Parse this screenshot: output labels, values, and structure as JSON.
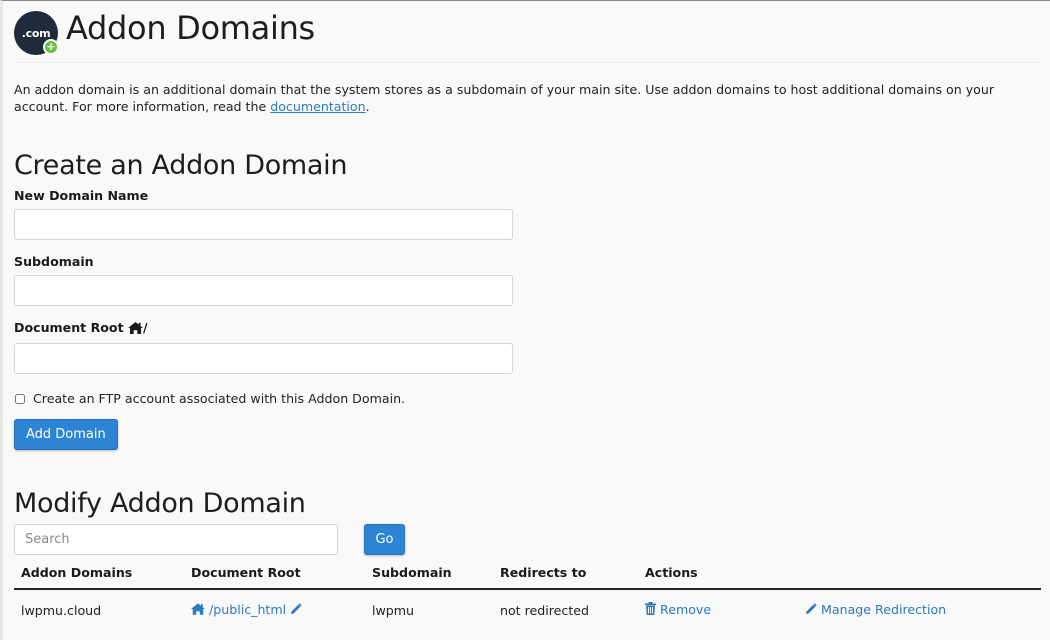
{
  "header": {
    "logo_text": ".com",
    "logo_badge": "+",
    "title": "Addon Domains"
  },
  "intro": {
    "text": "An addon domain is an additional domain that the system stores as a subdomain of your main site. Use addon domains to host additional domains on your account. For more information, read the ",
    "link_text": "documentation",
    "suffix": "."
  },
  "create": {
    "title": "Create an Addon Domain",
    "fields": [
      {
        "label": "New Domain Name",
        "value": "",
        "placeholder": ""
      },
      {
        "label": "Subdomain",
        "value": "",
        "placeholder": ""
      },
      {
        "label": "Document Root",
        "label_suffix": "/",
        "value": "",
        "placeholder": ""
      }
    ],
    "ftp_checkbox": {
      "label": "Create an FTP account associated with this Addon Domain.",
      "checked": false
    },
    "submit_label": "Add Domain"
  },
  "modify": {
    "title": "Modify Addon Domain",
    "search": {
      "placeholder": "Search",
      "value": ""
    },
    "go_label": "Go",
    "columns": [
      "Addon Domains",
      "Document Root",
      "Subdomain",
      "Redirects to",
      "Actions",
      ""
    ],
    "rows": [
      {
        "domain": "lwpmu.cloud",
        "document_root": "/public_html",
        "subdomain": "lwpmu",
        "redirects_to": "not redirected",
        "remove_label": "Remove",
        "manage_redirection_label": "Manage Redirection"
      }
    ]
  },
  "colors": {
    "accent": "#2d84d4",
    "link": "#2a7bc0",
    "logo_bg": "#1f2a3a",
    "logo_badge": "#6cbf3e"
  }
}
